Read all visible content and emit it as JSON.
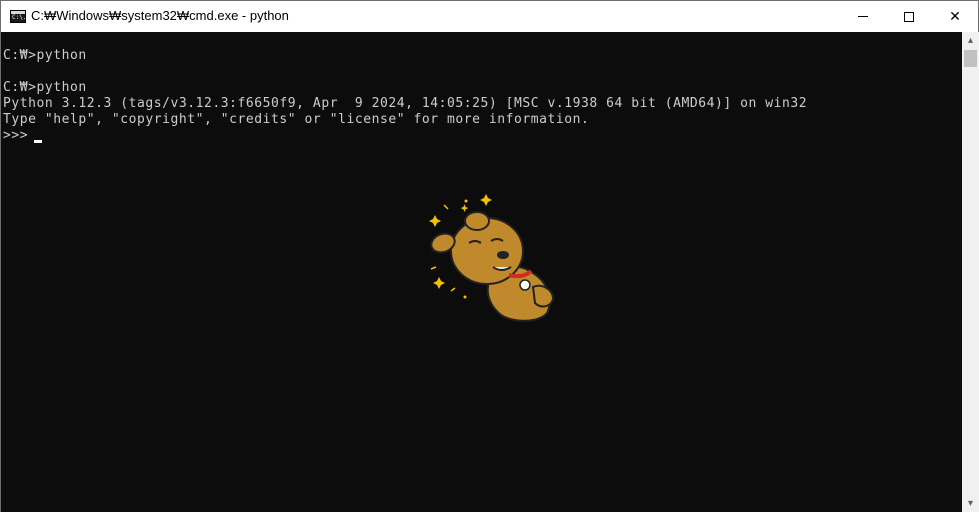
{
  "window": {
    "title": "C:₩Windows₩system32₩cmd.exe - python",
    "icon_text": "C:\\."
  },
  "controls": {
    "minimize_icon": "minimize-icon",
    "maximize_icon": "maximize-icon",
    "close_glyph": "✕"
  },
  "console": {
    "lines": [
      "",
      "C:₩>python",
      "",
      "C:₩>python",
      "Python 3.12.3 (tags/v3.12.3:f6650f9, Apr  9 2024, 14:05:25) [MSC v.1938 64 bit (AMD64)] on win32",
      "Type \"help\", \"copyright\", \"credits\" or \"license\" for more information.",
      ">>> "
    ]
  },
  "scrollbar": {
    "up_glyph": "▴",
    "down_glyph": "▾"
  },
  "colors": {
    "console_bg": "#0c0c0c",
    "console_text": "#cccccc",
    "titlebar_bg": "#ffffff"
  }
}
